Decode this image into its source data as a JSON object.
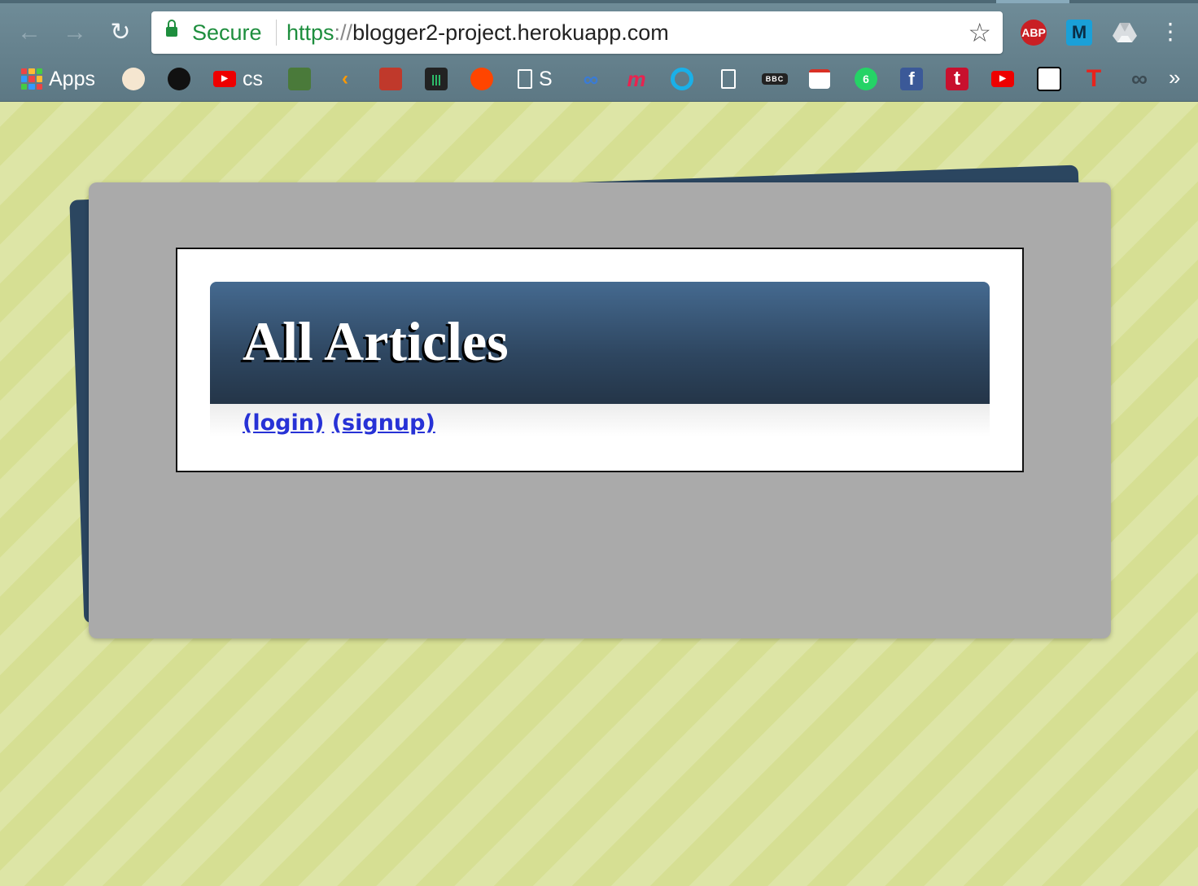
{
  "browser": {
    "secure_label": "Secure",
    "url_scheme": "https",
    "url_separator": "://",
    "url_host": "blogger2-project.herokuapp.com",
    "extensions": {
      "abp_label": "ABP",
      "m_label": "M"
    },
    "bookmarks": {
      "apps_label": "Apps",
      "cs_label": "cs",
      "s_label": "S",
      "bbc_label": "BBC",
      "whatsapp_badge": "6",
      "facebook_label": "f",
      "tumblr_label": "t",
      "t_label": "T"
    },
    "colors": {
      "secure_green": "#1e8e3e",
      "toolbar": "#6f8c98"
    }
  },
  "page": {
    "title": "All Articles",
    "links": {
      "login": "(login)",
      "signup": "(signup)"
    },
    "colors": {
      "background": "#d6df93",
      "card": "#aaaaaa",
      "header": "#2e4660",
      "link": "#2732d6"
    }
  }
}
